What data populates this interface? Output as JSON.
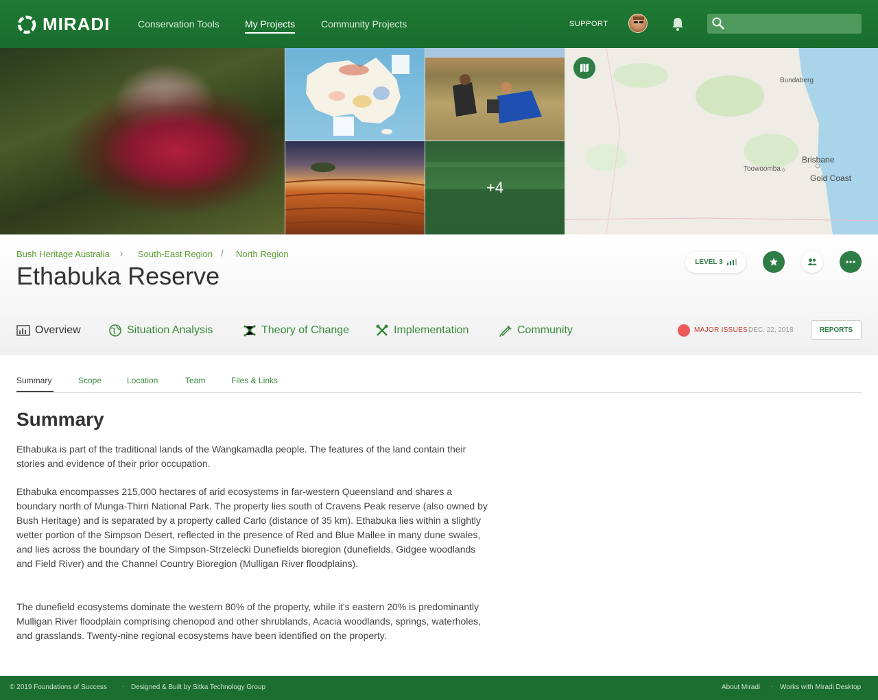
{
  "app": {
    "brand": "MIRADI",
    "nav": [
      "Conservation Tools",
      "My Projects",
      "Community Projects"
    ],
    "support_label": "SUPPORT",
    "search_placeholder": ""
  },
  "gallery": {
    "more_count": "+4",
    "map_labels": [
      "Bundaberg",
      "Brisbane",
      "Toowoomba",
      "Gold Coast"
    ]
  },
  "project": {
    "breadcrumb": [
      "Bush Heritage Australia",
      "South-East Region",
      "North Region"
    ],
    "title": "Ethabuka Reserve",
    "level_label": "LEVEL 3"
  },
  "tabs": [
    "Overview",
    "Situation Analysis",
    "Theory of Change",
    "Implementation",
    "Community"
  ],
  "status": {
    "label": "MAJOR ISSUES",
    "date": "DEC. 22, 2018",
    "color": "#ec5a5a"
  },
  "reports_label": "REPORTS",
  "subtabs": [
    "Summary",
    "Scope",
    "Location",
    "Team",
    "Files & Links"
  ],
  "summary": {
    "heading": "Summary",
    "paragraphs": [
      "Ethabuka is part of the traditional lands of the Wangkamadla people. The features of the land contain their stories and evidence of their prior occupation.",
      "Ethabuka encompasses 215,000 hectares of arid ecosystems in far-western Queensland and shares a boundary north of Munga-Thirri National Park.  The property lies south of Cravens Peak reserve (also owned by Bush Heritage) and is separated by a property called Carlo (distance of 35 km).  Ethabuka lies within a slightly wetter portion of the Simpson Desert, reflected in the presence of Red and Blue Mallee in many dune swales, and lies across the boundary of the Simpson-Strzelecki Dunefields bioregion (dunefields, Gidgee woodlands and Field River) and the Channel Country Bioregion (Mulligan River floodplains).",
      "The dunefield ecosystems dominate the western 80% of the property, while it's eastern 20% is predominantly Mulligan River floodplain comprising chenopod and other shrublands, Acacia woodlands, springs, waterholes, and grasslands. Twenty-nine regional ecosystems have been identified on the property."
    ]
  },
  "footer": {
    "copyright": "© 2019 Foundations of Success",
    "credit": "Designed & Built by Sitka Technology Group",
    "about": "About Miradi",
    "desktop": "Works with Miradi Desktop"
  },
  "colors": {
    "brand_green": "#1f7a34",
    "accent_green": "#2e7d46",
    "link_green": "#3a8a3e",
    "breadcrumb_green": "#5a9a2e"
  }
}
